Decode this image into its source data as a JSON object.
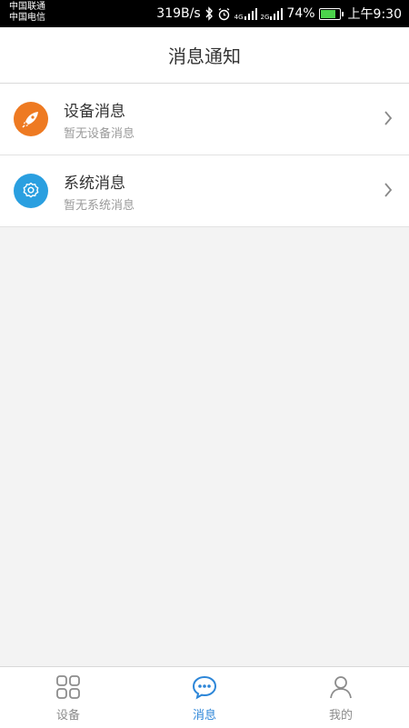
{
  "status_bar": {
    "carrier_1": "中国联通",
    "carrier_2": "中国电信",
    "net_speed": "319B/s",
    "network_1": "4G",
    "network_2": "2G",
    "battery_percent": "74%",
    "battery_level": 0.74,
    "time": "上午9:30",
    "icons": [
      "bluetooth-icon",
      "alarm-icon",
      "signal-icon",
      "signal-icon",
      "battery-icon"
    ]
  },
  "header": {
    "title": "消息通知"
  },
  "messages": [
    {
      "title": "设备消息",
      "subtitle": "暂无设备消息",
      "icon": "rocket-icon",
      "color": "#ee7a22"
    },
    {
      "title": "系统消息",
      "subtitle": "暂无系统消息",
      "icon": "gear-icon",
      "color": "#2a9fe0"
    }
  ],
  "tabs": [
    {
      "label": "设备",
      "icon": "grid-icon",
      "active": false
    },
    {
      "label": "消息",
      "icon": "chat-icon",
      "active": true
    },
    {
      "label": "我的",
      "icon": "person-icon",
      "active": false
    }
  ],
  "colors": {
    "accent": "#2d86d8",
    "inactive": "#8c8c8c"
  }
}
